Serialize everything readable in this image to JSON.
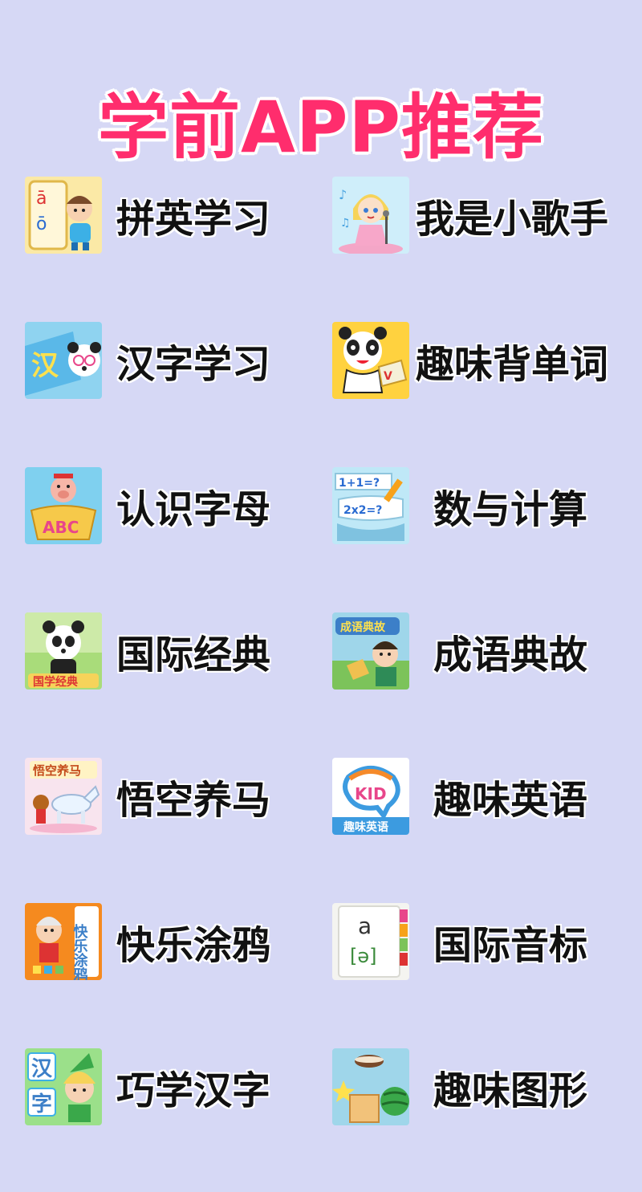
{
  "page": {
    "title": "学前APP推荐",
    "colors": {
      "background": "#d6d8f5",
      "title": "#ff2d6d"
    }
  },
  "apps": [
    {
      "label": "拼英学习",
      "icon": "pinyin-learning-icon"
    },
    {
      "label": "我是小歌手",
      "icon": "little-singer-icon"
    },
    {
      "label": "汉字学习",
      "icon": "hanzi-learning-icon"
    },
    {
      "label": "趣味背单词",
      "icon": "fun-words-icon"
    },
    {
      "label": "认识字母",
      "icon": "alphabet-icon"
    },
    {
      "label": "数与计算",
      "icon": "math-icon"
    },
    {
      "label": "国际经典",
      "icon": "classics-icon"
    },
    {
      "label": "成语典故",
      "icon": "idiom-stories-icon"
    },
    {
      "label": "悟空养马",
      "icon": "wukong-horse-icon"
    },
    {
      "label": "趣味英语",
      "icon": "kid-english-icon"
    },
    {
      "label": "快乐涂鸦",
      "icon": "doodle-icon"
    },
    {
      "label": "国际音标",
      "icon": "phonetics-icon"
    },
    {
      "label": "巧学汉字",
      "icon": "smart-hanzi-icon"
    },
    {
      "label": "趣味图形",
      "icon": "shapes-icon"
    }
  ],
  "icon_text": {
    "pinyin_a": "ā",
    "pinyin_o": "ō",
    "hanzi_han": "汉",
    "abc": "ABC",
    "math_1": "1+1=?",
    "math_2": "2x2=?",
    "classics_banner": "国学经典",
    "idiom_banner": "成语典故",
    "wukong_banner": "悟空养马",
    "kid": "KID",
    "kid_banner": "趣味英语",
    "doodle_banner": "快乐涂鸦",
    "phon_a": "a",
    "phon_schwa": "[ə]",
    "smart_han": "汉",
    "smart_zi": "字"
  }
}
